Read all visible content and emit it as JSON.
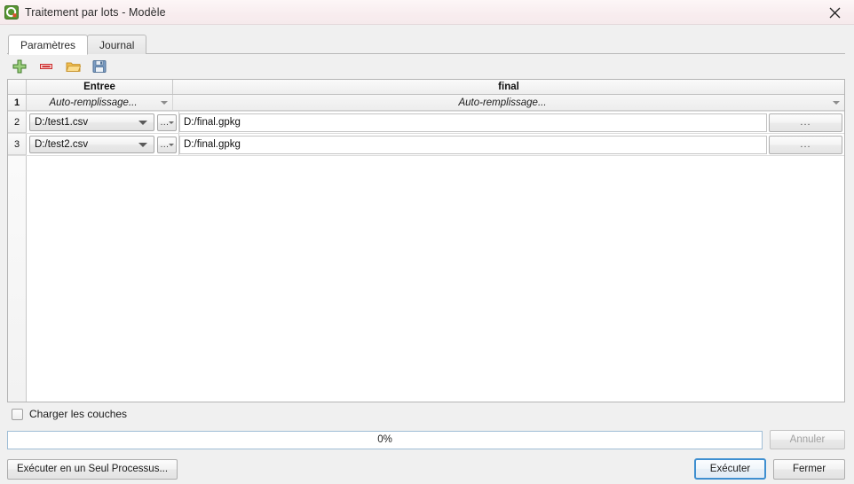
{
  "window": {
    "title": "Traitement par lots - Modèle",
    "app_icon": "qgis-icon",
    "close_icon": "close-icon"
  },
  "tabs": [
    {
      "label": "Paramètres",
      "active": true
    },
    {
      "label": "Journal",
      "active": false
    }
  ],
  "toolbar": [
    {
      "name": "add-row-button",
      "icon": "plus-icon"
    },
    {
      "name": "remove-row-button",
      "icon": "minus-icon"
    },
    {
      "name": "open-button",
      "icon": "folder-icon"
    },
    {
      "name": "save-button",
      "icon": "save-icon"
    }
  ],
  "table": {
    "columns": [
      {
        "label": "Entree"
      },
      {
        "label": "final"
      }
    ],
    "autofill_row": {
      "number": "1",
      "input_label": "Auto-remplissage...",
      "output_label": "Auto-remplissage..."
    },
    "rows": [
      {
        "number": "2",
        "input_value": "D:/test1.csv",
        "browse_label": "...",
        "output_value": "D:/final.gpkg",
        "output_browse_label": "..."
      },
      {
        "number": "3",
        "input_value": "D:/test2.csv",
        "browse_label": "...",
        "output_value": "D:/final.gpkg",
        "output_browse_label": "..."
      }
    ]
  },
  "options": {
    "load_layers_label": "Charger les couches",
    "load_layers_checked": false
  },
  "progress": {
    "percent_label": "0%",
    "value": 0,
    "cancel_label": "Annuler",
    "cancel_disabled": true
  },
  "actions": {
    "single_process_label": "Exécuter en un Seul Processus...",
    "run_label": "Exécuter",
    "close_label": "Fermer"
  },
  "colors": {
    "titlebar": "#f7eef0",
    "accent_blue": "#3f8fd0",
    "panel_bg": "#f0f0f0",
    "table_bg": "#ffffff"
  }
}
